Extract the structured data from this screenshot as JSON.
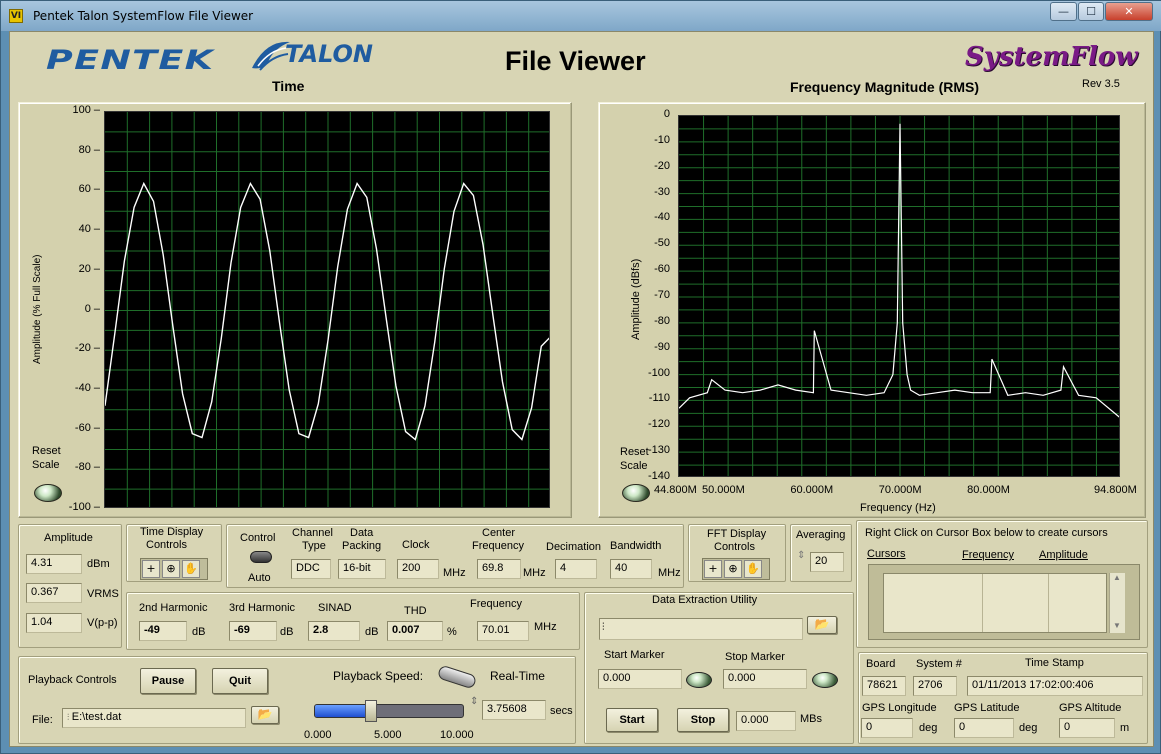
{
  "window": {
    "title": "Pentek Talon SystemFlow File Viewer",
    "app_icon_label": "VI",
    "btn_min": "—",
    "btn_max": "☐",
    "btn_close": "✕"
  },
  "header": {
    "title": "File Viewer",
    "pentek": "PENTEK",
    "talon": "TALON",
    "systemflow": "SystemFlow",
    "rev": "Rev 3.5"
  },
  "time_graph": {
    "title": "Time",
    "ylabel": "Amplitude (% Full Scale)",
    "yticks": [
      "100",
      "80",
      "60",
      "40",
      "20",
      "0",
      "-20",
      "-40",
      "-60",
      "-80",
      "-100"
    ],
    "reset_label1": "Reset",
    "reset_label2": "Scale"
  },
  "freq_graph": {
    "title": "Frequency Magnitude (RMS)",
    "ylabel": "Amplitude (dBfs)",
    "xlabel": "Frequency (Hz)",
    "yticks": [
      "0",
      "-10",
      "-20",
      "-30",
      "-40",
      "-50",
      "-60",
      "-70",
      "-80",
      "-90",
      "-100",
      "-110",
      "-120",
      "-130",
      "-140"
    ],
    "xticks": [
      "44.800M",
      "50.000M",
      "60.000M",
      "70.000M",
      "80.000M",
      "94.800M"
    ],
    "reset_label1": "Reset",
    "reset_label2": "Scale"
  },
  "chart_data": [
    {
      "type": "line",
      "title": "Time",
      "ylabel": "Amplitude (% Full Scale)",
      "ylim": [
        -100,
        100
      ],
      "series": [
        {
          "values": [
            -48,
            -12,
            25,
            52,
            64,
            55,
            28,
            -8,
            -42,
            -62,
            -64,
            -46,
            -14,
            24,
            52,
            64,
            56,
            30,
            -6,
            -40,
            -62,
            -64,
            -47,
            -15,
            22,
            51,
            64,
            57,
            31,
            -4,
            -38,
            -61,
            -65,
            -48,
            -16,
            21,
            50,
            64,
            58,
            33,
            -2,
            -36,
            -60,
            -65,
            -49,
            -18,
            -13
          ]
        }
      ],
      "grid": true
    },
    {
      "type": "line",
      "title": "Frequency Magnitude (RMS)",
      "xlabel": "Frequency (Hz)",
      "ylabel": "Amplitude (dBfs)",
      "ylim": [
        -140,
        0
      ],
      "xlim": [
        44.8,
        94.8
      ],
      "x_units": "MHz",
      "series": [
        {
          "x": [
            44.8,
            46,
            48,
            48.5,
            50,
            52,
            54,
            56,
            58,
            60,
            60.1,
            62,
            64,
            66,
            68,
            69,
            69.5,
            69.8,
            70.1,
            70.6,
            71,
            72,
            74,
            76,
            78,
            80,
            80.2,
            82,
            84,
            86,
            88,
            88.3,
            90,
            92,
            94.8
          ],
          "y": [
            -113,
            -109,
            -107,
            -102,
            -106,
            -107,
            -106,
            -104,
            -106,
            -107,
            -83,
            -106,
            -107,
            -108,
            -107,
            -100,
            -80,
            -3,
            -80,
            -100,
            -106,
            -108,
            -107,
            -106,
            -107,
            -107,
            -94,
            -108,
            -107,
            -108,
            -106,
            -97,
            -108,
            -109,
            -117
          ]
        }
      ],
      "grid": true
    }
  ],
  "amplitude": {
    "title": "Amplitude",
    "dbm": "4.31",
    "dbm_unit": "dBm",
    "vrms": "0.367",
    "vrms_unit": "VRMS",
    "vpp": "1.04",
    "vpp_unit": "V(p-p)"
  },
  "time_display": {
    "title1": "Time Display",
    "title2": "Controls"
  },
  "config": {
    "control": "Control",
    "control_value": "Auto",
    "channel_type_1": "Channel",
    "channel_type_2": "Type",
    "channel_type": "DDC",
    "data_packing_1": "Data",
    "data_packing_2": "Packing",
    "data_packing": "16-bit",
    "clock_label": "Clock",
    "clock": "200",
    "clock_unit": "MHz",
    "center_freq_1": "Center",
    "center_freq_2": "Frequency",
    "center_freq": "69.8",
    "center_freq_unit": "MHz",
    "decimation_label": "Decimation",
    "decimation": "4",
    "bandwidth_label": "Bandwidth",
    "bandwidth": "40",
    "bandwidth_unit": "MHz"
  },
  "fft_display": {
    "title1": "FFT Display",
    "title2": "Controls"
  },
  "averaging": {
    "label": "Averaging",
    "value": "20"
  },
  "cursors": {
    "hint": "Right Click on Cursor Box below to create cursors",
    "col1": "Cursors",
    "col2": "Frequency",
    "col3": "Amplitude"
  },
  "harmonics": {
    "h2_label": "2nd Harmonic",
    "h2": "-49",
    "h2_unit": "dB",
    "h3_label": "3rd Harmonic",
    "h3": "-69",
    "h3_unit": "dB",
    "sinad_label": "SINAD",
    "sinad": "2.8",
    "sinad_unit": "dB",
    "thd_label": "THD",
    "thd": "0.007",
    "thd_unit": "%",
    "freq_label": "Frequency",
    "freq": "70.01",
    "freq_unit": "MHz"
  },
  "extraction": {
    "title": "Data Extraction Utility",
    "path": "",
    "start_label": "Start Marker",
    "start": "0.000",
    "stop_label": "Stop Marker",
    "stop": "0.000",
    "start_btn": "Start",
    "stop_btn": "Stop",
    "mbs": "0.000",
    "mbs_unit": "MBs"
  },
  "playback": {
    "title": "Playback Controls",
    "pause": "Pause",
    "quit": "Quit",
    "speed_label": "Playback Speed:",
    "realtime": "Real-Time",
    "file_label": "File:",
    "file": "E:\\test.dat",
    "slider_min": "0.000",
    "slider_mid": "5.000",
    "slider_max": "10.000",
    "slider_value": "3.75608",
    "slider_unit": "secs",
    "slider_fraction": 0.38
  },
  "board": {
    "board_label": "Board",
    "board": "78621",
    "system_label": "System #",
    "system": "2706",
    "ts_label": "Time Stamp",
    "timestamp": "01/11/2013 17:02:00:406",
    "lon_label": "GPS Longitude",
    "lon": "0",
    "lon_unit": "deg",
    "lat_label": "GPS Latitude",
    "lat": "0",
    "lat_unit": "deg",
    "alt_label": "GPS Altitude",
    "alt": "0",
    "alt_unit": "m"
  }
}
